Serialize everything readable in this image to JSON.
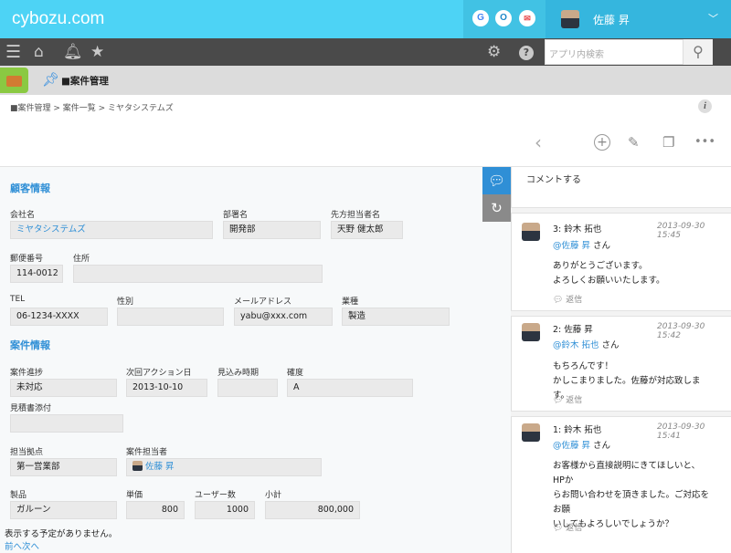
{
  "header": {
    "logo": "cybozu.com",
    "icons": [
      {
        "icon": "google-icon",
        "glyph": "G",
        "color": "#4285f4"
      },
      {
        "icon": "office-icon",
        "glyph": "O",
        "color": "#1e88c8"
      },
      {
        "icon": "mail-icon",
        "glyph": "✉",
        "color": "#e8464a"
      }
    ],
    "user_name": "佐藤 昇",
    "user_menu_icon": "chevron-down-icon"
  },
  "nav": {
    "search_placeholder": "アプリ内検索",
    "icons": [
      "menu-icon",
      "home-icon",
      "bell-icon",
      "star-icon",
      "gear-icon",
      "help-icon",
      "search-icon"
    ]
  },
  "app": {
    "title": "■案件管理",
    "breadcrumb": "■案件管理   >   案件一覧   >   ミヤタシステムズ",
    "info_icon": "i"
  },
  "record": {
    "customer_section": "顧客情報",
    "company_label": "会社名",
    "company_value": "ミヤタシステムズ",
    "dept_label": "部署名",
    "dept_value": "開発部",
    "contact_label": "先方担当者名",
    "contact_value": "天野 健太郎",
    "zip_label": "郵便番号",
    "zip_value": "114-0012",
    "address_label": "住所",
    "address_value": "",
    "tel_label": "TEL",
    "tel_value": "06-1234-XXXX",
    "gender_label": "性別",
    "gender_value": "",
    "email_label": "メールアドレス",
    "email_value": "yabu@xxx.com",
    "industry_label": "業種",
    "industry_value": "製造",
    "deal_section": "案件情報",
    "progress_label": "案件進捗",
    "progress_value": "未対応",
    "next_action_label": "次回アクション日",
    "next_action_value": "2013-10-10",
    "expected_label": "見込み時期",
    "expected_value": "",
    "certainty_label": "確度",
    "certainty_value": "A",
    "quote_label": "見積書添付",
    "quote_value": "",
    "branch_label": "担当拠点",
    "branch_value": "第一営業部",
    "owner_label": "案件担当者",
    "owner_value": "佐藤 昇",
    "product_label": "製品",
    "product_value": "ガルーン",
    "unit_price_label": "単価",
    "unit_price_value": "800",
    "users_label": "ユーザー数",
    "users_value": "1000",
    "subtotal_label": "小計",
    "subtotal_value": "800,000",
    "no_schedule": "表示する予定がありません。",
    "pager": "前へ次へ"
  },
  "comments": {
    "prompt": "コメントする",
    "reply_label": "返信",
    "items": [
      {
        "head": "3: 鈴木 拓也",
        "date": "2013-09-30 15:45",
        "mention": "@佐藤 昇",
        "honorific": " さん",
        "body": [
          "ありがとうございます。",
          "よろしくお願いいたします。"
        ]
      },
      {
        "head": "2: 佐藤 昇",
        "date": "2013-09-30 15:42",
        "mention": "@鈴木 拓也",
        "honorific": " さん",
        "body": [
          "もちろんです！",
          "かしこまりました。佐藤が対応致します。"
        ]
      },
      {
        "head": "1: 鈴木 拓也",
        "date": "2013-09-30 15:41",
        "mention": "@佐藤 昇",
        "honorific": " さん",
        "body": [
          "お客様から直接説明にきてほしいと、HPか",
          "らお問い合わせを頂きました。ご対応をお願",
          "いしてもよろしいでしょうか？"
        ]
      }
    ]
  },
  "colors": {
    "topbar": "#4dd3f5",
    "nav": "#4a4a4a",
    "accent": "#2f8fd6",
    "comment_tab": "#2f8fd6",
    "history_tab": "#8a8a8a"
  }
}
